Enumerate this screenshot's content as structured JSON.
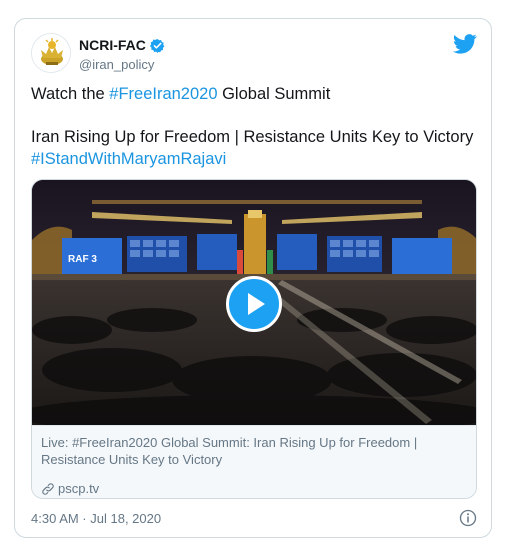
{
  "account": {
    "name": "NCRI-FAC",
    "handle": "@iran_policy"
  },
  "tweet": {
    "line1_prefix": "Watch the ",
    "line1_hashtag": "#FreeIran2020",
    "line1_suffix": " Global Summit",
    "line2": "Iran Rising Up for Freedom | Resistance Units Key to Victory",
    "line3_hashtag": "#IStandWithMaryamRajavi"
  },
  "media": {
    "screen_text": "RAF 3",
    "link_title": "Live: #FreeIran2020 Global Summit: Iran Rising Up for Freedom | Resistance Units Key to Victory",
    "link_domain": "pscp.tv"
  },
  "footer": {
    "timestamp": "4:30 AM · Jul 18, 2020"
  },
  "colors": {
    "accent": "#1da1f2",
    "hashtag": "#1b95e0"
  },
  "icons": [
    "avatar-logo-icon",
    "verified-icon",
    "twitter-bird-icon",
    "play-icon",
    "link-icon",
    "info-icon"
  ]
}
